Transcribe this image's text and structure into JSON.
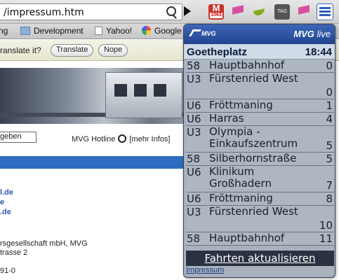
{
  "browser": {
    "url": "/impressum.htm",
    "gmail_badge": "M",
    "gmail_count": "1063",
    "ext_label": "TAG"
  },
  "bookmarks": [
    {
      "label": "ng",
      "icon": "none"
    },
    {
      "label": "Development",
      "icon": "folder-icon"
    },
    {
      "label": "Yahoo!",
      "icon": "page-icon"
    },
    {
      "label": "Google",
      "icon": "google-icon"
    }
  ],
  "translate": {
    "question": "ranslate it?",
    "translate_label": "Translate",
    "nope_label": "Nope"
  },
  "page": {
    "field_value": "geben",
    "hotline_label": "MVG Hotline",
    "more_info": "[mehr Infos]",
    "links": [
      "l.de",
      "e",
      ".de"
    ],
    "address": [
      "rsgesellschaft mbH, MVG",
      "trasse 2",
      "",
      "91-0"
    ]
  },
  "popup": {
    "logo": "MVG",
    "title": "MVG",
    "title_suffix": "live",
    "station": "Goetheplatz",
    "time": "18:44",
    "departures": [
      {
        "line": "58",
        "destination": "Hauptbahnhof",
        "minutes": "0"
      },
      {
        "line": "U3",
        "destination": "Fürstenried West",
        "minutes": "0"
      },
      {
        "line": "U6",
        "destination": "Fröttmaning",
        "minutes": "1"
      },
      {
        "line": "U6",
        "destination": "Harras",
        "minutes": "4"
      },
      {
        "line": "U3",
        "destination": "Olympia - Einkaufszentrum",
        "minutes": "5"
      },
      {
        "line": "58",
        "destination": "Silberhornstraße",
        "minutes": "5"
      },
      {
        "line": "U6",
        "destination": "Klinikum Großhadern",
        "minutes": "7"
      },
      {
        "line": "U6",
        "destination": "Fröttmaning",
        "minutes": "8"
      },
      {
        "line": "U3",
        "destination": "Fürstenried West",
        "minutes": "10"
      },
      {
        "line": "58",
        "destination": "Hauptbahnhof",
        "minutes": "11"
      }
    ],
    "refresh_label": "Fahrten aktualisieren",
    "impressum_label": "Impressum"
  }
}
